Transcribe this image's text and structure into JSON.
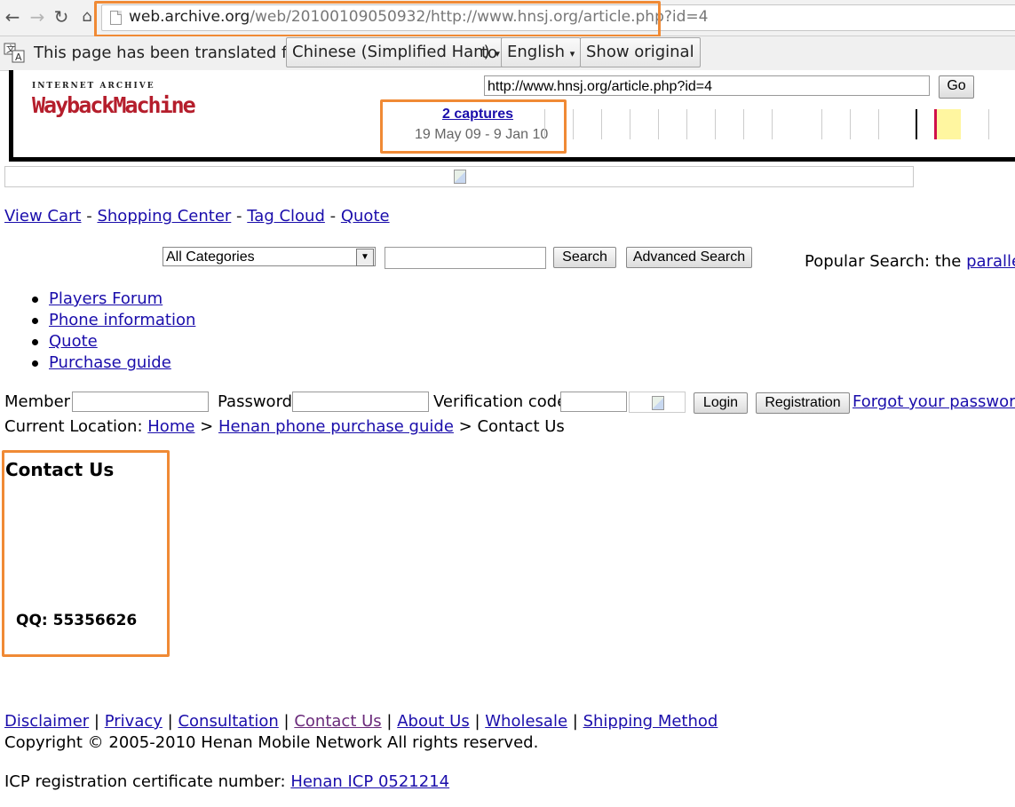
{
  "browser": {
    "url_host": "web.archive.org",
    "url_path": "/web/20100109050932/http://www.hnsj.org/article.php?id=4"
  },
  "translate_bar": {
    "prefix": "This page has been translated from",
    "from_language": "Chinese (Simplified Han)",
    "connector": "to",
    "to_language": "English",
    "show_original": "Show original"
  },
  "wayback": {
    "logo_top": "INTERNET ARCHIVE",
    "logo": "WaybackMachine",
    "url_value": "http://www.hnsj.org/article.php?id=4",
    "go": "Go",
    "captures": "2 captures",
    "date_range": "19 May 09 - 9 Jan 10"
  },
  "nav_links": [
    "View Cart",
    "Shopping Center",
    "Tag Cloud",
    "Quote"
  ],
  "nav_separator": "-",
  "search": {
    "category_selected": "All Categories",
    "search_button": "Search",
    "advanced_button": "Advanced Search",
    "popular_label": "Popular Search: the",
    "popular_link": "parallel"
  },
  "menu": [
    "Players Forum",
    "Phone information",
    "Quote",
    "Purchase guide"
  ],
  "login": {
    "member": "Member",
    "password": "Password",
    "verification": "Verification code",
    "login_button": "Login",
    "registration_button": "Registration",
    "forgot": "Forgot your password"
  },
  "location": {
    "label": "Current Location:",
    "home": "Home",
    "section": "Henan phone purchase guide",
    "current": "Contact Us",
    "separator": ">"
  },
  "content": {
    "title": "Contact Us",
    "qq": "QQ: 55356626"
  },
  "footer": {
    "links": [
      "Disclaimer",
      "Privacy",
      "Consultation",
      "Contact Us",
      "About Us",
      "Wholesale",
      "Shipping Method"
    ],
    "separator": "|",
    "copyright": "Copyright © 2005-2010 Henan Mobile Network All rights reserved.",
    "icp_label": "ICP registration certificate number:",
    "icp_link": "Henan ICP 0521214"
  },
  "colors": {
    "highlight": "#f08a35",
    "link": "#1a0dab",
    "visited_link": "#6a2a7a",
    "wayback_red": "#b51e2c"
  }
}
